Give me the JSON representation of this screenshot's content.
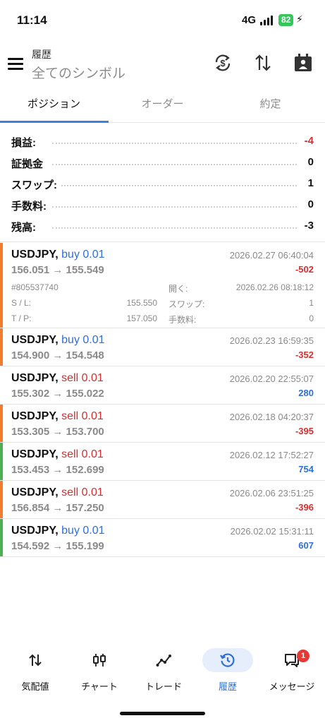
{
  "status": {
    "time": "11:14",
    "network": "4G",
    "battery": "82"
  },
  "header": {
    "title": "履歴",
    "subtitle": "全てのシンボル"
  },
  "tabs": [
    {
      "label": "ポジション",
      "active": true
    },
    {
      "label": "オーダー",
      "active": false
    },
    {
      "label": "約定",
      "active": false
    }
  ],
  "summary": [
    {
      "label": "損益:",
      "value": "-4",
      "tone": "neg"
    },
    {
      "label": "証拠金",
      "value": "0",
      "tone": ""
    },
    {
      "label": "スワップ:",
      "value": "1",
      "tone": ""
    },
    {
      "label": "手数料:",
      "value": "0",
      "tone": ""
    },
    {
      "label": "残高:",
      "value": "-3",
      "tone": ""
    }
  ],
  "trades": [
    {
      "symbol": "USDJPY,",
      "side": "buy 0.01",
      "side_color": "#2f6fd6",
      "prices": "156.051 → 155.549",
      "date": "2026.02.27 06:40:04",
      "pnl": "-502",
      "pnl_tone": "neg",
      "accent": "#ef7d2d",
      "expanded": true,
      "details": {
        "ticket": "#805537740",
        "sl_label": "S / L:",
        "sl_value": "155.550",
        "tp_label": "T / P:",
        "tp_value": "157.050",
        "open_label": "開く:",
        "open_value": "2026.02.26 08:18:12",
        "swap_label": "スワップ:",
        "swap_value": "1",
        "fee_label": "手数料:",
        "fee_value": "0"
      }
    },
    {
      "symbol": "USDJPY,",
      "side": "buy 0.01",
      "side_color": "#2f6fd6",
      "prices": "154.900 → 154.548",
      "date": "2026.02.23 16:59:35",
      "pnl": "-352",
      "pnl_tone": "neg",
      "accent": "#ef7d2d"
    },
    {
      "symbol": "USDJPY,",
      "side": "sell 0.01",
      "side_color": "#d32f2f",
      "prices": "155.302 → 155.022",
      "date": "2026.02.20 22:55:07",
      "pnl": "280",
      "pnl_tone": "pos",
      "accent": ""
    },
    {
      "symbol": "USDJPY,",
      "side": "sell 0.01",
      "side_color": "#d32f2f",
      "prices": "153.305 → 153.700",
      "date": "2026.02.18 04:20:37",
      "pnl": "-395",
      "pnl_tone": "neg",
      "accent": "#ef7d2d"
    },
    {
      "symbol": "USDJPY,",
      "side": "sell 0.01",
      "side_color": "#d32f2f",
      "prices": "153.453 → 152.699",
      "date": "2026.02.12 17:52:27",
      "pnl": "754",
      "pnl_tone": "pos",
      "accent": "#4caf50"
    },
    {
      "symbol": "USDJPY,",
      "side": "sell 0.01",
      "side_color": "#d32f2f",
      "prices": "156.854 → 157.250",
      "date": "2026.02.06 23:51:25",
      "pnl": "-396",
      "pnl_tone": "neg",
      "accent": "#ef7d2d"
    },
    {
      "symbol": "USDJPY,",
      "side": "buy 0.01",
      "side_color": "#2f6fd6",
      "prices": "154.592 → 155.199",
      "date": "2026.02.02 15:31:11",
      "pnl": "607",
      "pnl_tone": "pos",
      "accent": "#4caf50"
    }
  ],
  "nav": [
    {
      "label": "気配値",
      "icon": "quotes-icon",
      "active": false
    },
    {
      "label": "チャート",
      "icon": "chart-icon",
      "active": false
    },
    {
      "label": "トレード",
      "icon": "trade-icon",
      "active": false
    },
    {
      "label": "履歴",
      "icon": "history-icon",
      "active": true
    },
    {
      "label": "メッセージ",
      "icon": "messages-icon",
      "active": false,
      "badge": "1"
    }
  ]
}
